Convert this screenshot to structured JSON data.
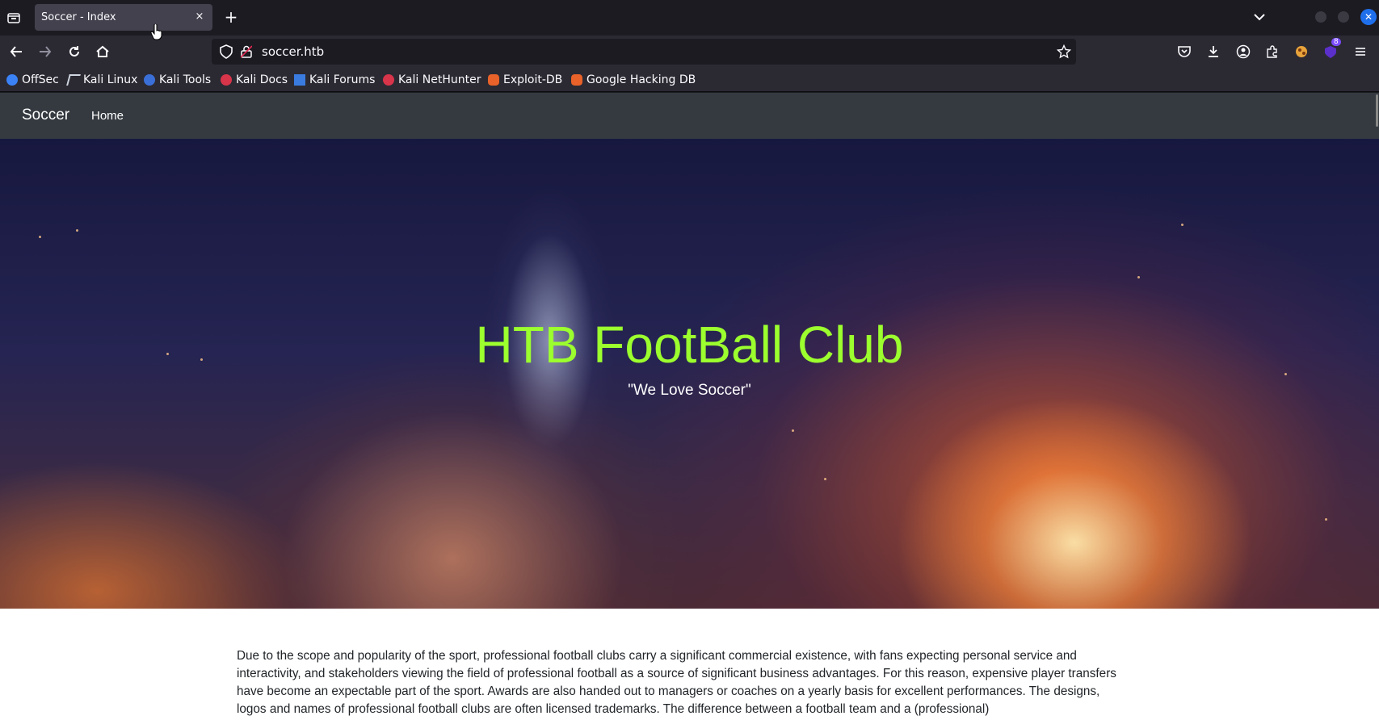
{
  "browser": {
    "tab_title": "Soccer - Index",
    "tab_close": "×",
    "new_tab": "+",
    "url": "soccer.htb",
    "extensions_badge": "8",
    "bookmarks": [
      "OffSec",
      "Kali Linux",
      "Kali Tools",
      "Kali Docs",
      "Kali Forums",
      "Kali NetHunter",
      "Exploit-DB",
      "Google Hacking DB"
    ]
  },
  "site": {
    "brand": "Soccer",
    "nav_home": "Home",
    "hero_title": "HTB FootBall Club",
    "hero_subtitle": "\"We Love Soccer\"",
    "paragraph": "Due to the scope and popularity of the sport, professional football clubs carry a significant commercial existence, with fans expecting personal service and interactivity, and stakeholders viewing the field of professional football as a source of significant business advantages. For this reason, expensive player transfers have become an expectable part of the sport. Awards are also handed out to managers or coaches on a yearly basis for excellent performances. The designs, logos and names of professional football clubs are often licensed trademarks. The difference between a football team and a (professional)"
  },
  "colors": {
    "hero_title": "#9cff2e",
    "site_nav_bg": "#343a40",
    "browser_bg": "#1c1b22"
  }
}
